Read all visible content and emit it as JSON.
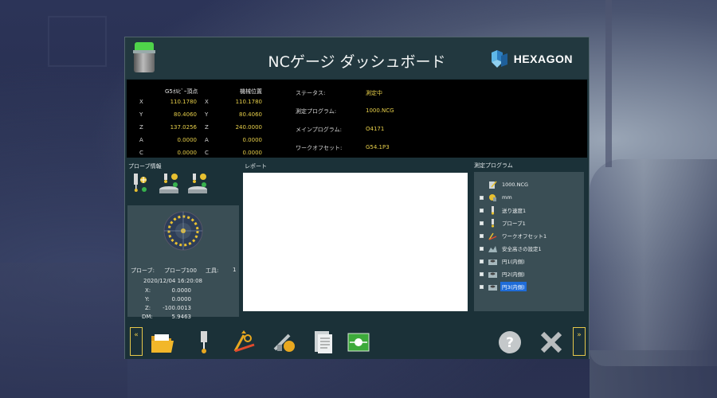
{
  "window": {
    "title": "NCゲージ ダッシュボード",
    "logo_text": "HEXAGON"
  },
  "position_readout": {
    "header_g5": "G5ｵﾙﾋﾞｰ頂点",
    "header_machine": "機械位置",
    "rows": [
      {
        "axis": "X",
        "g5": "110.1780",
        "axis2": "X",
        "machine": "110.1780"
      },
      {
        "axis": "Y",
        "g5": "80.4060",
        "axis2": "Y",
        "machine": "80.4060"
      },
      {
        "axis": "Z",
        "g5": "137.0256",
        "axis2": "Z",
        "machine": "240.0000"
      },
      {
        "axis": "A",
        "g5": "0.0000",
        "axis2": "A",
        "machine": "0.0000"
      },
      {
        "axis": "C",
        "g5": "0.0000",
        "axis2": "C",
        "machine": "0.0000"
      }
    ]
  },
  "status": {
    "items": [
      {
        "label": "ステータス:",
        "value": "測定中"
      },
      {
        "label": "測定プログラム:",
        "value": "1000.NCG"
      },
      {
        "label": "メインプログラム:",
        "value": "O4171"
      },
      {
        "label": "ワークオフセット:",
        "value": "G54.1P3"
      }
    ]
  },
  "probe_info": {
    "title": "プローブ情報",
    "probe_label": "プローブ:",
    "probe_value": "プローブ100",
    "tool_label": "工具:",
    "tool_value": "1",
    "timestamp": "2020/12/04 16:20:08",
    "x_label": "X:",
    "x_value": "0.0000",
    "y_label": "Y:",
    "y_value": "0.0000",
    "z_label": "Z:",
    "z_value": "-100.0013",
    "dm_label": "DM:",
    "dm_value": "5.9463"
  },
  "report": {
    "title": "レポート"
  },
  "program_tree": {
    "title": "測定プログラム",
    "items": [
      {
        "label": "1000.NCG",
        "icon": "document-icon"
      },
      {
        "label": "mm",
        "icon": "units-icon"
      },
      {
        "label": "送り速度1",
        "icon": "feedrate-icon"
      },
      {
        "label": "プローブ1",
        "icon": "probe-icon"
      },
      {
        "label": "ワークオフセット1",
        "icon": "work-offset-icon"
      },
      {
        "label": "安全高さの設定1",
        "icon": "safety-height-icon"
      },
      {
        "label": "円1(内側)",
        "icon": "circle-feature-icon"
      },
      {
        "label": "円2(内側)",
        "icon": "circle-feature-icon"
      },
      {
        "label": "円3(内側)",
        "icon": "circle-feature-icon",
        "selected": true
      }
    ]
  },
  "toolbar": {
    "left_nav": "«",
    "right_nav": "»",
    "buttons": [
      "open-folder-icon",
      "probe-icon",
      "work-offset-icon",
      "caliper-icon",
      "report-doc-icon",
      "run-icon",
      "help-icon",
      "close-icon"
    ]
  },
  "colors": {
    "accent_yellow": "#e8d04a",
    "selection_blue": "#1f6cd8",
    "status_green": "#4fd34a"
  }
}
